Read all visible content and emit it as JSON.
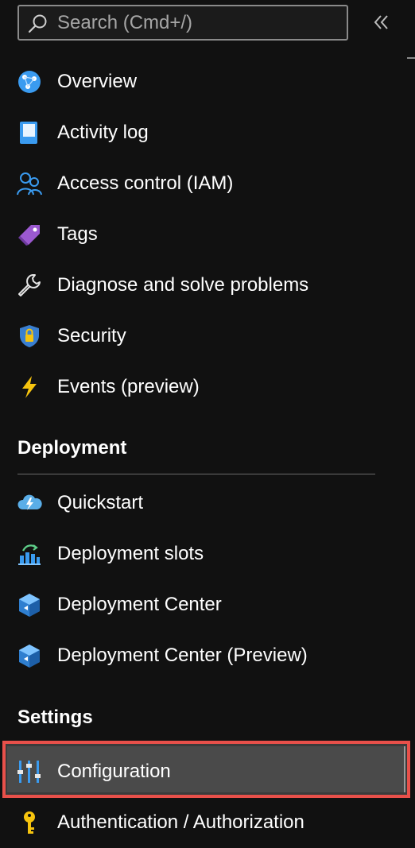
{
  "search": {
    "placeholder": "Search (Cmd+/)"
  },
  "nav": {
    "top_items": [
      {
        "label": "Overview",
        "icon": "globe-icon"
      },
      {
        "label": "Activity log",
        "icon": "log-book-icon"
      },
      {
        "label": "Access control (IAM)",
        "icon": "people-icon"
      },
      {
        "label": "Tags",
        "icon": "tag-icon"
      },
      {
        "label": "Diagnose and solve problems",
        "icon": "wrench-icon"
      },
      {
        "label": "Security",
        "icon": "shield-lock-icon"
      },
      {
        "label": "Events (preview)",
        "icon": "lightning-icon"
      }
    ],
    "deployment": {
      "header": "Deployment",
      "items": [
        {
          "label": "Quickstart",
          "icon": "cloud-lightning-icon"
        },
        {
          "label": "Deployment slots",
          "icon": "slots-icon"
        },
        {
          "label": "Deployment Center",
          "icon": "cube-icon"
        },
        {
          "label": "Deployment Center (Preview)",
          "icon": "cube-icon"
        }
      ]
    },
    "settings": {
      "header": "Settings",
      "items": [
        {
          "label": "Configuration",
          "icon": "sliders-icon",
          "selected": true
        },
        {
          "label": "Authentication / Authorization",
          "icon": "key-icon"
        }
      ]
    }
  },
  "colors": {
    "background": "#111111",
    "selection_border": "#e8504a",
    "accent_blue": "#3a9bf0",
    "tag_purple": "#9b59d0",
    "lightning_yellow": "#f6c40e"
  }
}
